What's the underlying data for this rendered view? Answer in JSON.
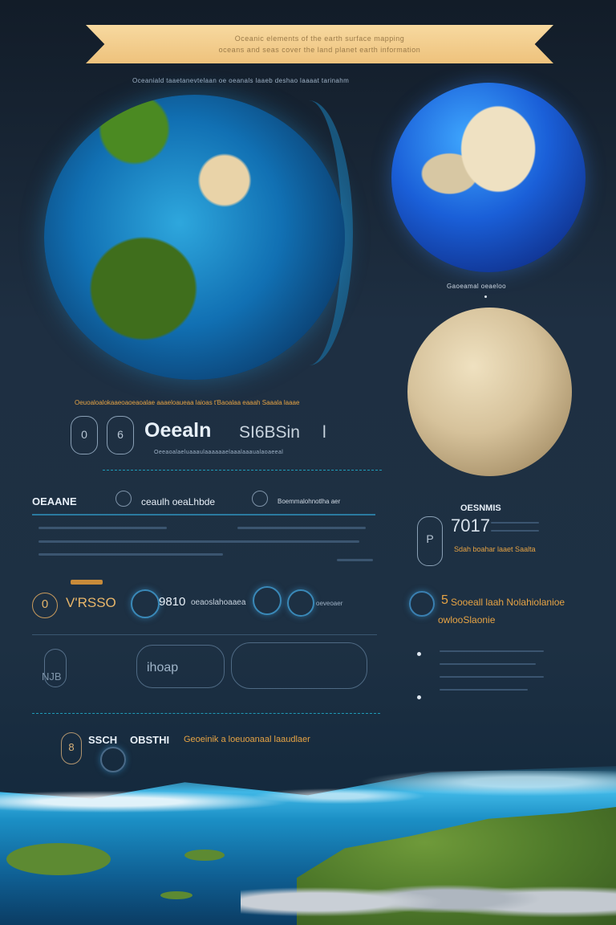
{
  "banner": {
    "line1": "Oceanic elements of the earth surface mapping",
    "line2": "oceans and seas cover the land planet earth information"
  },
  "subtitle": "Oceaniald taaetanevtelaan oe oeanals laaeb deshao laaaat tarinahm",
  "moon_label": "Gaoeamal oeaeloo",
  "gold_caption_1": "Oeuoaloalokaaeoaoeaoalae aaaeloaueaa laioas t'Baoalaa eaaah Saaala laaae",
  "hero_title": "Oeealn",
  "hero_title_2": "SI6BSin",
  "hero_title_2_suffix": "l",
  "hero_small": "Oeeaoalaeluaaaulaaaaaaelaaalaaaualaoaeeal",
  "hero_icon_1": "0",
  "hero_icon_2": "6",
  "section2": {
    "label_a": "OEAANE",
    "label_b": "ceaulh oeaLhbde",
    "label_c": "Boemmalohnotlha aer"
  },
  "stat": {
    "title": "OESNMIS",
    "value": "7017",
    "small": "Sdah boahar laaet Saalta",
    "icon": "P"
  },
  "row3": {
    "icon_num": "0",
    "a": "V'RSSO",
    "b": "9810",
    "c": "oeaoslahoaaea",
    "d": "oeveoaer"
  },
  "gold_note": {
    "num": "5",
    "text": "Sooeall laah Nolahiolanioe",
    "sub": "owlooSlaonie"
  },
  "row4": {
    "a": "NJB",
    "b": "ihoap"
  },
  "bottom": {
    "a": "SSCH",
    "b": "OBSTHI",
    "c": "Geoeinik a loeuoanaal laaudlaer",
    "icon": "8"
  },
  "colors": {
    "gold": "#e6a344",
    "teal": "#1e9bb8",
    "banner": "#f2cd8c"
  },
  "icons": [
    "paperclip-icon",
    "globe-icon",
    "gear-icon",
    "wave-icon"
  ]
}
